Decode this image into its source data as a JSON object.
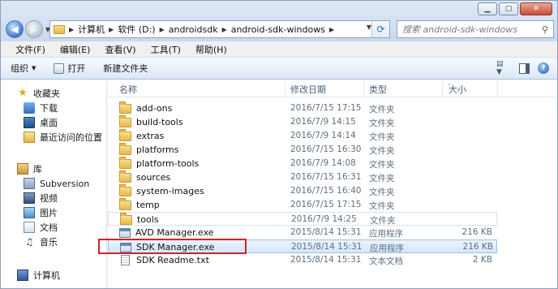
{
  "window": {
    "caption_buttons": [
      "minimize",
      "maximize",
      "close"
    ]
  },
  "address_bar": {
    "crumbs": [
      "计算机",
      "软件 (D:)",
      "androidsdk",
      "android-sdk-windows"
    ]
  },
  "search": {
    "placeholder": "搜索 android-sdk-windows"
  },
  "menu": [
    "文件(F)",
    "编辑(E)",
    "查看(V)",
    "工具(T)",
    "帮助(H)"
  ],
  "toolbar": {
    "organize": "组织",
    "open": "打开",
    "new_folder": "新建文件夹"
  },
  "nav": {
    "favorites": "收藏夹",
    "favorites_items": [
      "下载",
      "桌面",
      "最近访问的位置"
    ],
    "libraries": "库",
    "library_items": [
      "Subversion",
      "视频",
      "图片",
      "文档",
      "音乐"
    ],
    "computer": "计算机"
  },
  "columns": {
    "name": "名称",
    "date": "修改日期",
    "type": "类型",
    "size": "大小"
  },
  "files": [
    {
      "name": "add-ons",
      "date": "2016/7/15 17:15",
      "type": "文件夹",
      "size": "",
      "kind": "folder"
    },
    {
      "name": "build-tools",
      "date": "2016/7/9 14:15",
      "type": "文件夹",
      "size": "",
      "kind": "folder"
    },
    {
      "name": "extras",
      "date": "2016/7/9 14:14",
      "type": "文件夹",
      "size": "",
      "kind": "folder"
    },
    {
      "name": "platforms",
      "date": "2016/7/15 16:30",
      "type": "文件夹",
      "size": "",
      "kind": "folder"
    },
    {
      "name": "platform-tools",
      "date": "2016/7/9 14:08",
      "type": "文件夹",
      "size": "",
      "kind": "folder"
    },
    {
      "name": "sources",
      "date": "2016/7/15 16:31",
      "type": "文件夹",
      "size": "",
      "kind": "folder"
    },
    {
      "name": "system-images",
      "date": "2016/7/15 16:40",
      "type": "文件夹",
      "size": "",
      "kind": "folder"
    },
    {
      "name": "temp",
      "date": "2016/7/15 17:15",
      "type": "文件夹",
      "size": "",
      "kind": "folder"
    },
    {
      "name": "tools",
      "date": "2016/7/9 14:25",
      "type": "文件夹",
      "size": "",
      "kind": "folder"
    },
    {
      "name": "AVD Manager.exe",
      "date": "2015/8/14 15:31",
      "type": "应用程序",
      "size": "216 KB",
      "kind": "exe"
    },
    {
      "name": "SDK Manager.exe",
      "date": "2015/8/14 15:31",
      "type": "应用程序",
      "size": "216 KB",
      "kind": "exe",
      "selected": true
    },
    {
      "name": "SDK Readme.txt",
      "date": "2015/8/14 15:31",
      "type": "文本文档",
      "size": "2 KB",
      "kind": "txt"
    }
  ],
  "colors": {
    "highlight_box": "#d6202a",
    "selection": "#d5e7fb"
  }
}
